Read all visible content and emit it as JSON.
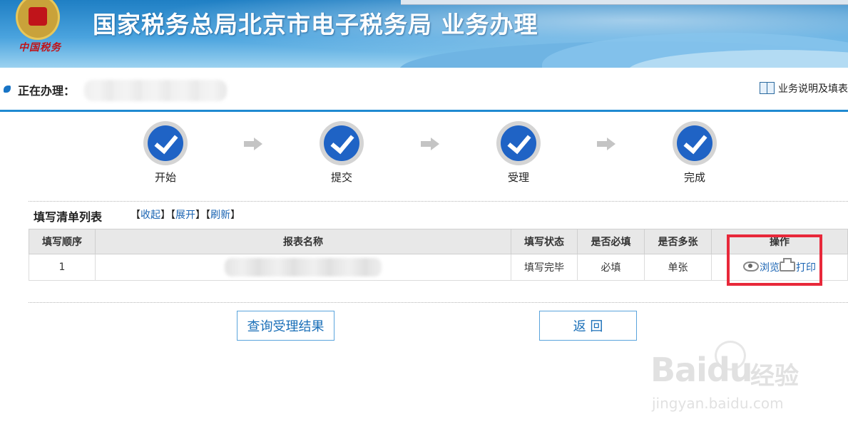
{
  "banner": {
    "emblem_caption": "中国税务",
    "title": "国家税务总局北京市电子税务局  业务办理"
  },
  "processing": {
    "label": "正在办理：",
    "help_link": "业务说明及填表"
  },
  "steps": [
    {
      "label": "开始"
    },
    {
      "label": "提交"
    },
    {
      "label": "受理"
    },
    {
      "label": "完成"
    }
  ],
  "list": {
    "title": "填写清单列表",
    "actions": [
      "收起",
      "展开",
      "刷新"
    ],
    "columns": [
      "填写顺序",
      "报表名称",
      "填写状态",
      "是否必填",
      "是否多张",
      "操作"
    ],
    "rows": [
      {
        "order": "1",
        "name": "",
        "status": "填写完毕",
        "required": "必填",
        "multiple": "单张",
        "op_view": "浏览",
        "op_print": "打印"
      }
    ]
  },
  "buttons": {
    "query": "查询受理结果",
    "back": "返  回"
  },
  "watermark": {
    "logo": "Baidu",
    "logo_cn": "经验",
    "url": "jingyan.baidu.com"
  },
  "colors": {
    "accent": "#1f8ad1",
    "link": "#1a64b3",
    "highlight": "#e8283a"
  }
}
